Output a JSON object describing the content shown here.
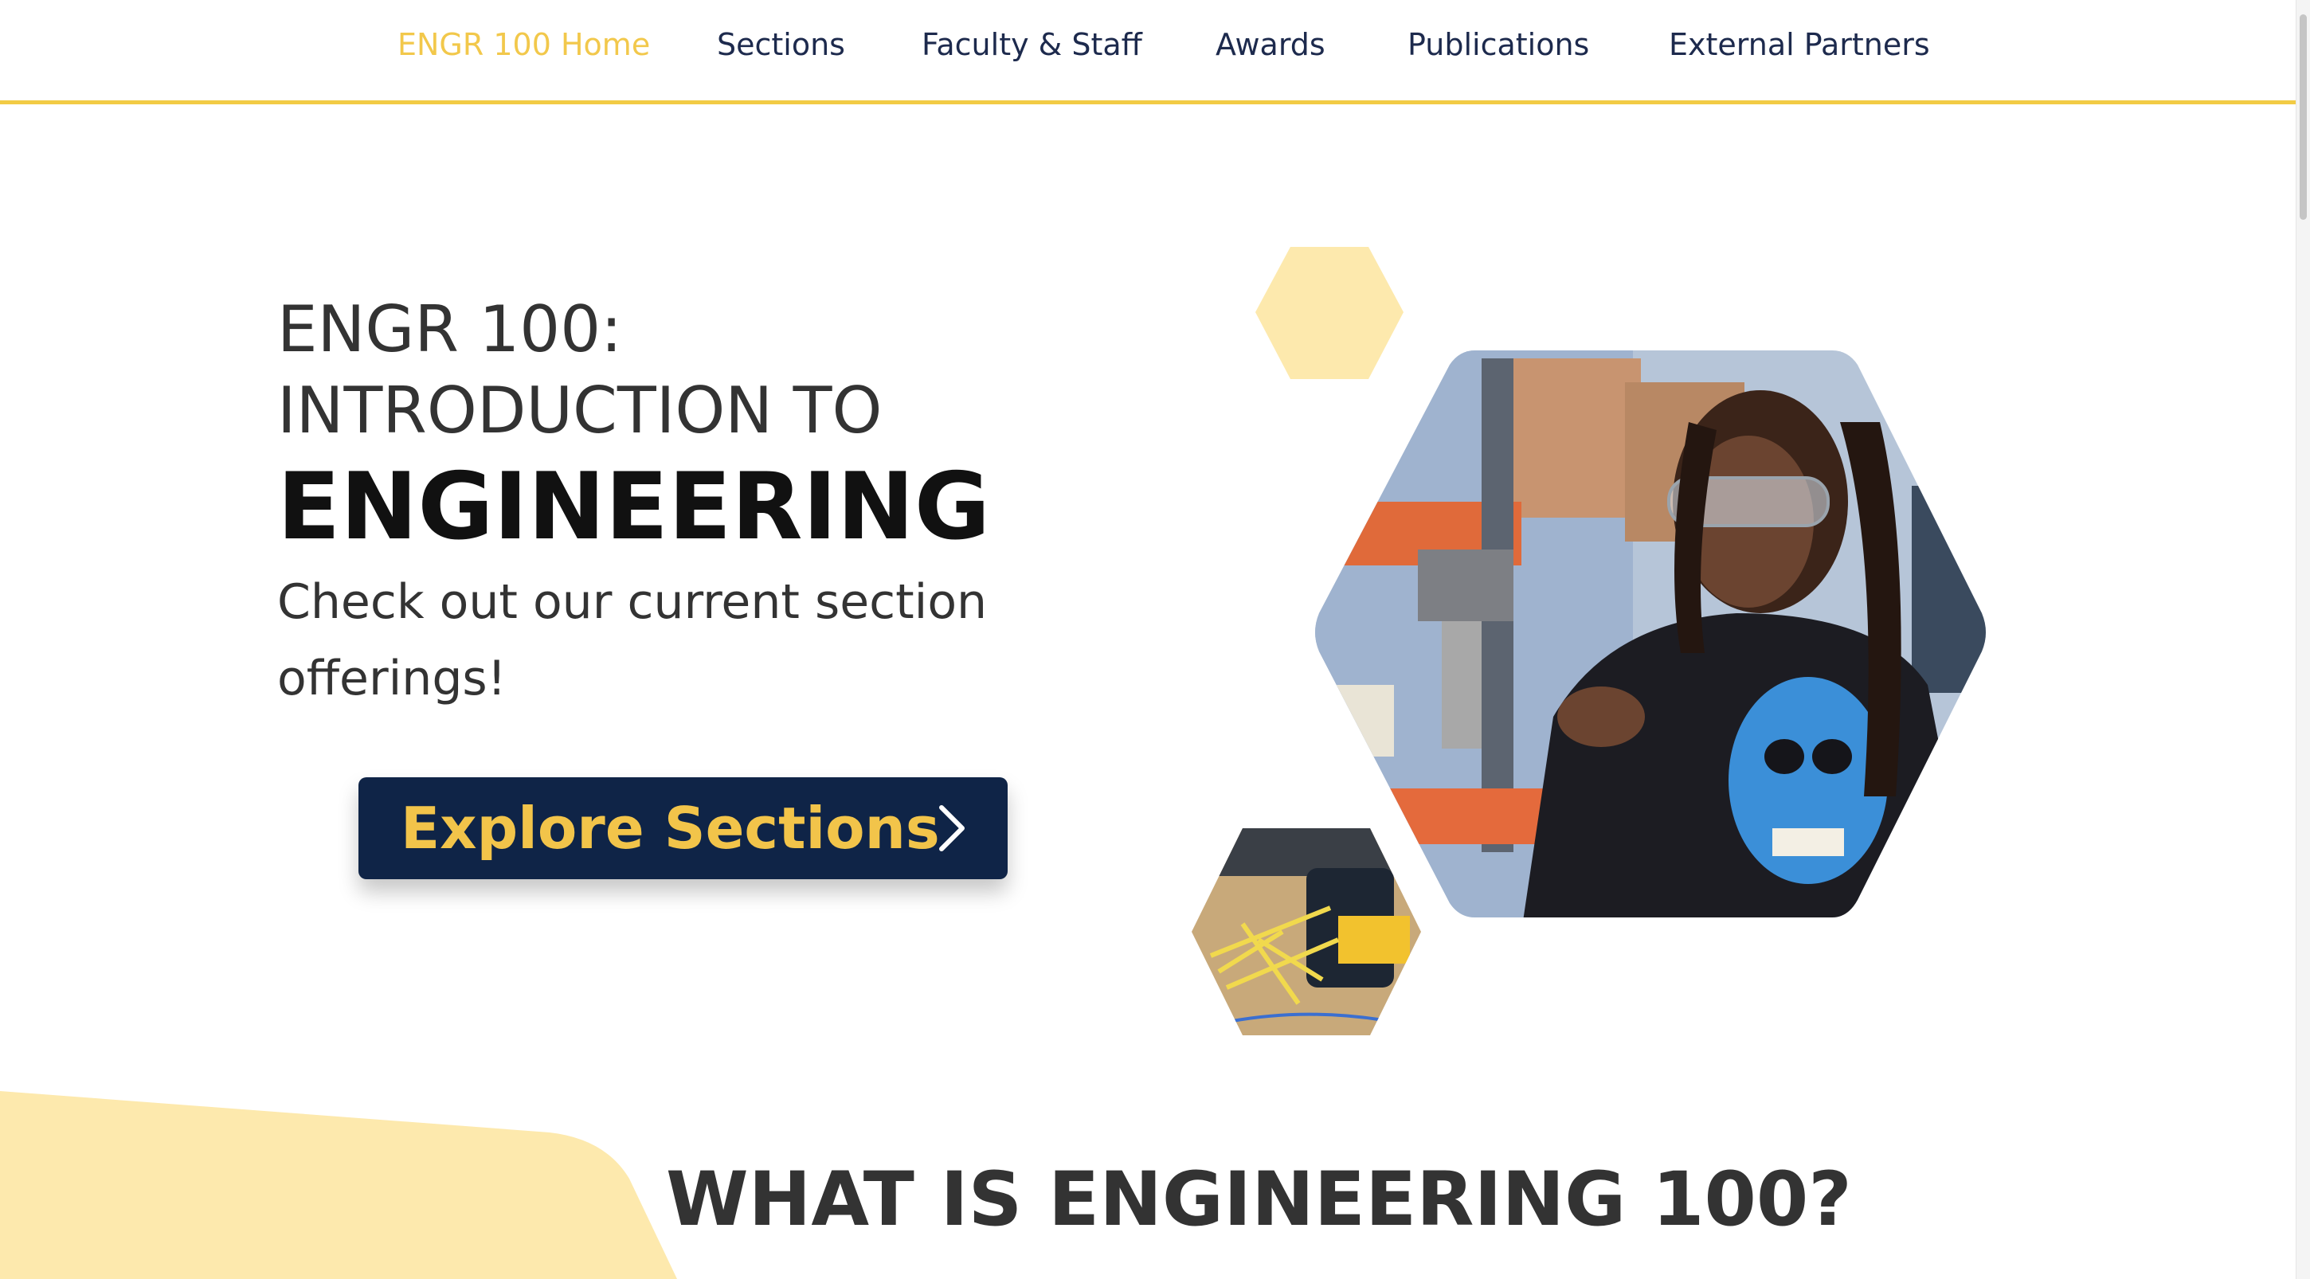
{
  "nav": {
    "items": [
      {
        "label": "ENGR 100 Home",
        "active": true
      },
      {
        "label": "Sections",
        "active": false
      },
      {
        "label": "Faculty & Staff",
        "active": false
      },
      {
        "label": "Awards",
        "active": false
      },
      {
        "label": "Publications",
        "active": false
      },
      {
        "label": "External Partners",
        "active": false
      }
    ]
  },
  "hero": {
    "title_line1": "ENGR 100:",
    "title_line2": "INTRODUCTION TO",
    "title_line3": "ENGINEERING",
    "subtitle": "Check out our current section offerings!",
    "cta_label": "Explore Sections",
    "cta_icon": "chevron-right-icon"
  },
  "section": {
    "heading": "WHAT IS ENGINEERING 100?"
  },
  "colors": {
    "accent_yellow": "#f2cb45",
    "navy": "#0f2447",
    "pale_yellow": "#fde9ad",
    "text": "#333333"
  }
}
